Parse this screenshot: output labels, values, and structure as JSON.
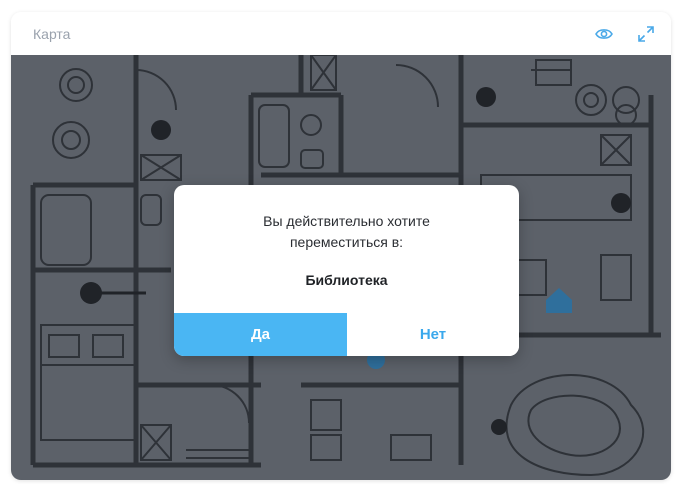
{
  "card": {
    "title": "Карта",
    "view_icon": "eye-icon",
    "expand_icon": "expand-icon"
  },
  "dialog": {
    "question_line1": "Вы действительно хотите",
    "question_line2": "переместиться в:",
    "destination": "Библиотека",
    "yes_label": "Да",
    "no_label": "Нет"
  },
  "colors": {
    "accent": "#4ab6f3",
    "map_overlay": "#5c6169",
    "map_marker": "#2f6f9c"
  }
}
